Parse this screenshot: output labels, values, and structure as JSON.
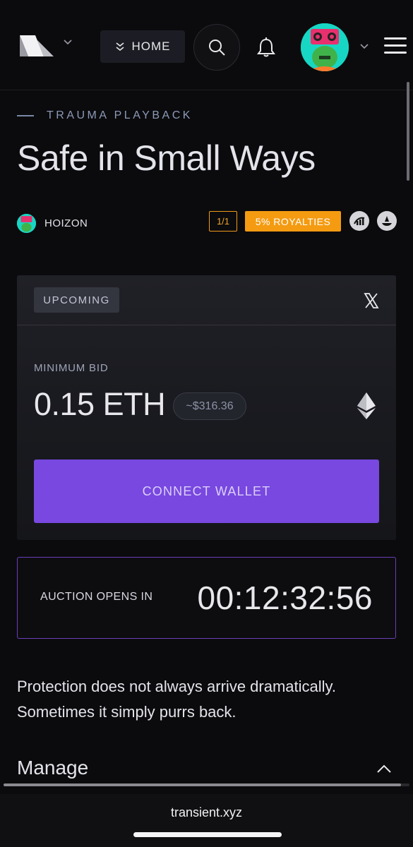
{
  "nav": {
    "home_label": "HOME"
  },
  "artwork": {
    "collection": "TRAUMA PLAYBACK",
    "title": "Safe in Small Ways",
    "artist": "HOIZON",
    "edition": "1/1",
    "royalties": "5% ROYALTIES"
  },
  "auction": {
    "status": "UPCOMING",
    "min_bid_label": "MINIMUM BID",
    "min_bid_value": "0.15 ETH",
    "usd_value": "~$316.36",
    "connect_label": "CONNECT WALLET",
    "opens_label": "AUCTION OPENS IN",
    "countdown": "00:12:32:56"
  },
  "description": "Protection does not always arrive dramatically. Sometimes it simply purrs back.",
  "manage": {
    "title": "Manage"
  },
  "browser": {
    "url": "transient.xyz"
  },
  "colors": {
    "accent_purple": "#7848e0",
    "royalties_orange": "#f49b12",
    "avatar_teal": "#18d6c4"
  },
  "icons": [
    "logo-icon",
    "chevron-down-icon",
    "search-icon",
    "bell-icon",
    "menu-icon",
    "x-icon",
    "ethereum-icon",
    "chevron-up-icon"
  ]
}
